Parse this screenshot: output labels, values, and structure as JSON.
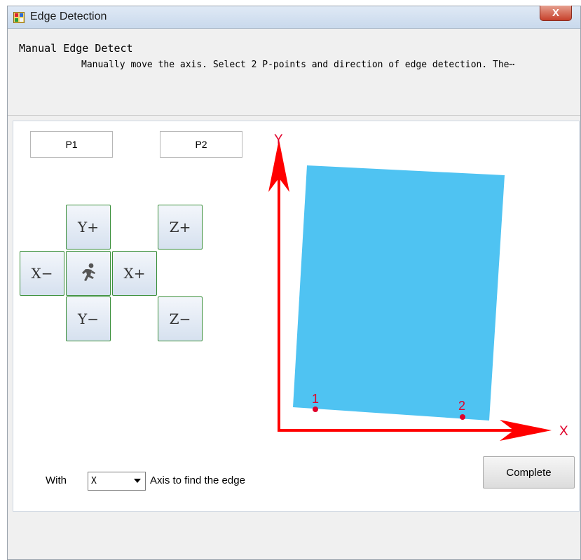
{
  "window": {
    "title": "Edge Detection",
    "close_label": "X"
  },
  "header": {
    "title": "Manual Edge Detect",
    "description": "Manually move the axis. Select 2 P-points and direction of edge detection. The⋯"
  },
  "points": {
    "p1_label": "P1",
    "p2_label": "P2"
  },
  "jog": {
    "y_plus": "Y+",
    "y_minus": "Y−",
    "x_plus": "X+",
    "x_minus": "X−",
    "z_plus": "Z+",
    "z_minus": "Z−",
    "center_icon": "running-man-icon"
  },
  "diagram": {
    "y_label": "Y",
    "x_label": "X",
    "point1_label": "1",
    "point2_label": "2",
    "plate_color": "#4fc3f2",
    "axis_color": "#ff0000",
    "point_color": "#e0002a"
  },
  "axis_select": {
    "prefix_label": "With",
    "selected": "X",
    "suffix_label": "Axis to find the edge"
  },
  "complete_label": "Complete"
}
